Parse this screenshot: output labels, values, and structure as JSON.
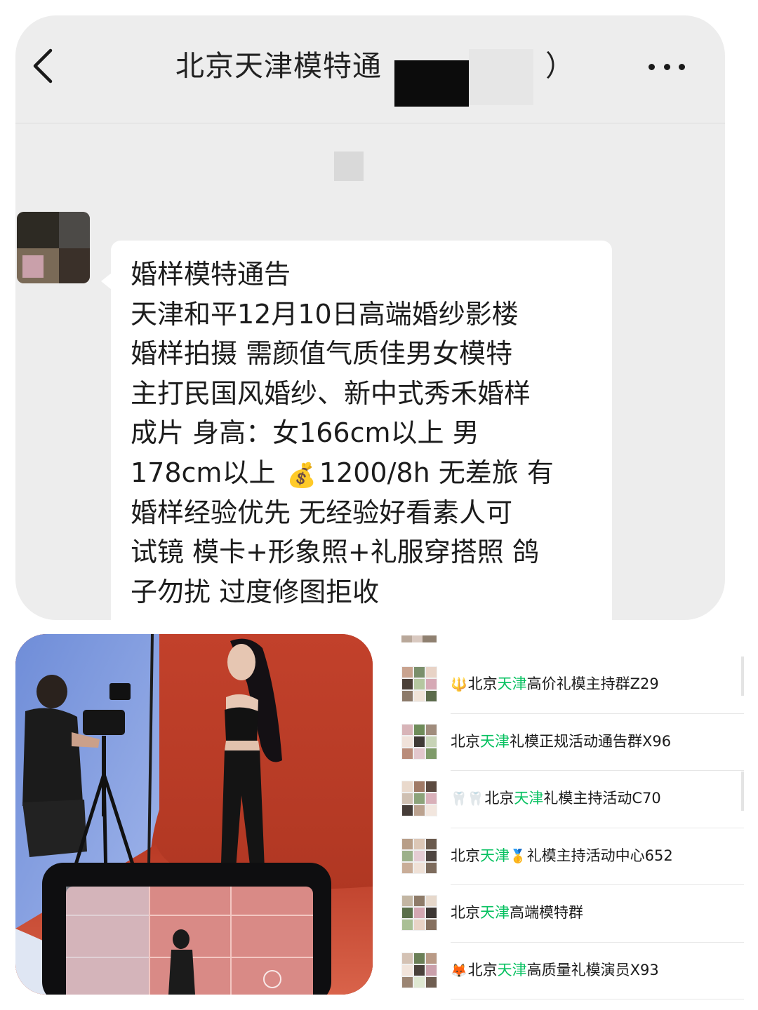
{
  "chat": {
    "title": "北京天津模特通",
    "title_suffix": "）",
    "message_lines": [
      "婚样模特通告",
      "天津和平12月10日高端婚纱影楼",
      "婚样拍摄 需颜值气质佳男女模特",
      "主打民国风婚纱、新中式秀禾婚样",
      "成片 身高：女166cm以上 男",
      "178cm以上",
      "1200/8h 无差旅 有",
      "婚样经验优先 无经验好看素人可",
      "试镜 模卡+形象照+礼服穿搭照 鸽",
      "子勿扰 过度修图拒收"
    ],
    "money_emoji": "💰"
  },
  "groups": [
    {
      "prefix_emoji": "🔱",
      "pre": "北京",
      "highlight": "天津",
      "mid_emoji": "",
      "post": "高价礼模主持群Z29"
    },
    {
      "prefix_emoji": "",
      "pre": "北京",
      "highlight": "天津",
      "mid_emoji": "",
      "post": "礼模正规活动通告群X96"
    },
    {
      "prefix_emoji": "🦷🦷",
      "pre": "北京",
      "highlight": "天津",
      "mid_emoji": "",
      "post": "礼模主持活动C70"
    },
    {
      "prefix_emoji": "",
      "pre": "北京",
      "highlight": "天津",
      "mid_emoji": "🥇",
      "post": "礼模主持活动中心652"
    },
    {
      "prefix_emoji": "",
      "pre": "北京",
      "highlight": "天津",
      "mid_emoji": "",
      "post": "高端模特群"
    },
    {
      "prefix_emoji": "🦊",
      "pre": "北京",
      "highlight": "天津",
      "mid_emoji": "",
      "post": "高质量礼模演员X93"
    }
  ],
  "colors": {
    "highlight": "#07c160",
    "chat_background": "#ededed",
    "bubble": "#ffffff"
  },
  "icons": {
    "back": "chevron-left-icon",
    "more": "more-dots-icon"
  }
}
